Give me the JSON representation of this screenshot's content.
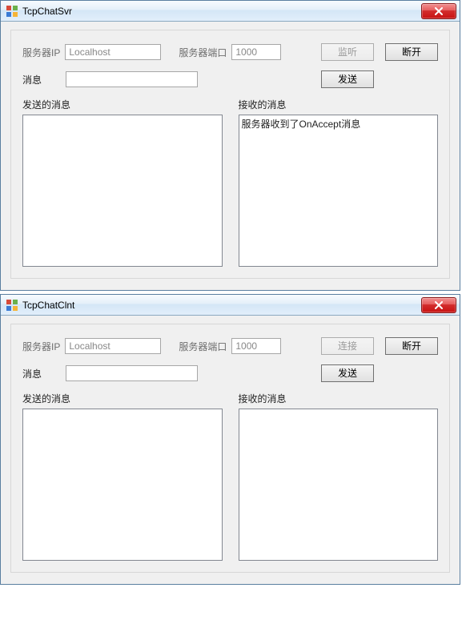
{
  "server_window": {
    "title": "TcpChatSvr",
    "ip_label": "服务器IP",
    "ip_value": "Localhost",
    "port_label": "服务器端口",
    "port_value": "1000",
    "listen_button": "监听",
    "disconnect_button": "断开",
    "message_label": "消息",
    "message_value": "",
    "send_button": "发送",
    "sent_label": "发送的消息",
    "sent_content": "",
    "received_label": "接收的消息",
    "received_content": "服务器收到了OnAccept消息"
  },
  "client_window": {
    "title": "TcpChatClnt",
    "ip_label": "服务器IP",
    "ip_value": "Localhost",
    "port_label": "服务器端口",
    "port_value": "1000",
    "connect_button": "连接",
    "disconnect_button": "断开",
    "message_label": "消息",
    "message_value": "",
    "send_button": "发送",
    "sent_label": "发送的消息",
    "sent_content": "",
    "received_label": "接收的消息",
    "received_content": ""
  }
}
